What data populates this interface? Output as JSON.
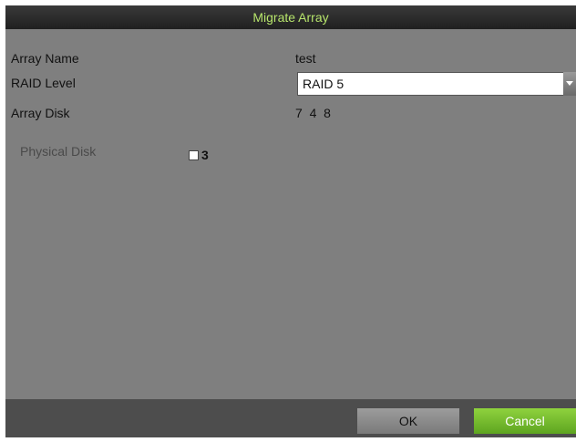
{
  "dialog": {
    "title": "Migrate Array"
  },
  "fields": {
    "array_name": {
      "label": "Array Name",
      "value": "test"
    },
    "raid_level": {
      "label": "RAID Level",
      "value": "RAID 5"
    },
    "array_disk": {
      "label": "Array Disk",
      "value": "7  4  8"
    }
  },
  "physical_disk": {
    "label": "Physical Disk",
    "options": [
      {
        "label": "3",
        "checked": false
      }
    ]
  },
  "buttons": {
    "ok": "OK",
    "cancel": "Cancel"
  },
  "colors": {
    "title_text": "#b6e46b",
    "cancel_button": "#6cb82a",
    "dialog_bg": "#7f7f7f",
    "footer_bg": "#4d4d4d"
  },
  "icons": [
    "chevron-down-icon"
  ]
}
